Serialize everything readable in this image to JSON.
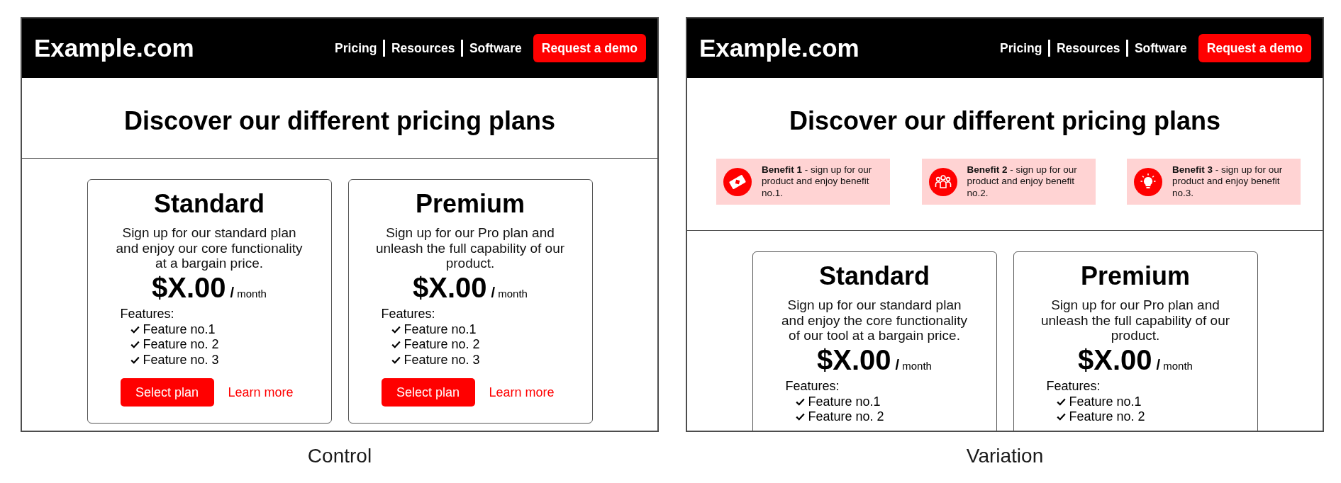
{
  "mockups": [
    {
      "caption": "Control",
      "header": {
        "logo": "Example.com",
        "nav": [
          "Pricing",
          "Resources",
          "Software"
        ],
        "cta": "Request a demo"
      },
      "heading": "Discover our different pricing plans",
      "plans": [
        {
          "name": "Standard",
          "description": "Sign up for our standard plan and enjoy our core functionality at a bargain price.",
          "price": "$X.00",
          "period": "**/** month",
          "features_label": "Features:",
          "features": [
            "Feature no.1",
            "Feature no. 2",
            "Feature no. 3"
          ],
          "actions": {
            "primary": "Select plan",
            "secondary": "Learn more"
          }
        },
        {
          "name": "Premium",
          "description": "Sign up for our Pro plan and unleash the full capability of our product.",
          "price": "$X.00",
          "period": "**/** month",
          "features_label": "Features:",
          "features": [
            "Feature no.1",
            "Feature no. 2",
            "Feature no. 3"
          ],
          "actions": {
            "primary": "Select plan",
            "secondary": "Learn more"
          }
        }
      ]
    },
    {
      "caption": "Variation",
      "header": {
        "logo": "Example.com",
        "nav": [
          "Pricing",
          "Resources",
          "Software"
        ],
        "cta": "Request a demo"
      },
      "heading": "Discover our different pricing plans",
      "benefits": [
        {
          "text": "**Benefit 1** - sign up for our product and enjoy benefit no.1."
        },
        {
          "text": "**Benefit 2** - sign up for our product and enjoy benefit no.2."
        },
        {
          "text": "**Benefit 3** - sign up for our product and enjoy benefit no.3."
        }
      ],
      "plans": [
        {
          "name": "Standard",
          "description": "Sign up for our standard plan and enjoy the core functionality of our tool at a bargain price.",
          "price": "$X.00",
          "period": "**/** month",
          "features_label": "Features:",
          "features": [
            "Feature no.1",
            "Feature no. 2"
          ]
        },
        {
          "name": "Premium",
          "description": "Sign up for our Pro plan and unleash the full capability of our product.",
          "price": "$X.00",
          "period": "**/** month",
          "features_label": "Features:",
          "features": [
            "Feature no.1",
            "Feature no. 2"
          ]
        }
      ]
    }
  ]
}
